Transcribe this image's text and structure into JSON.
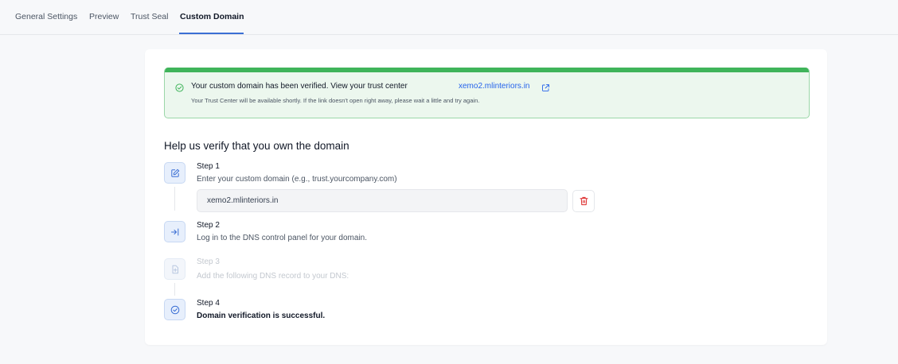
{
  "tabs": [
    {
      "label": "General Settings"
    },
    {
      "label": "Preview"
    },
    {
      "label": "Trust Seal"
    },
    {
      "label": "Custom Domain",
      "active": true
    }
  ],
  "alert": {
    "icon": "check-circle-icon",
    "title": "Your custom domain has been verified.  View your trust center",
    "link_text": "xemo2.mlinteriors.in",
    "link_icon": "external-link-icon",
    "subtitle": "Your Trust Center will be available shortly. If the link doesn't open right away, please wait a little and try again.",
    "colors": {
      "bar": "#3fb45a",
      "background": "#ecf7ee",
      "link": "#2563eb"
    }
  },
  "heading": "Help us verify that you own the domain",
  "steps": [
    {
      "title": "Step 1",
      "description": "Enter your custom domain (e.g., trust.yourcompany.com)",
      "icon": "edit-icon",
      "enabled": true
    },
    {
      "title": "Step 2",
      "description": "Log in to the DNS control panel for your domain.",
      "icon": "login-arrow-icon",
      "enabled": true
    },
    {
      "title": "Step 3",
      "description": "Add the following DNS record to your DNS:",
      "icon": "file-add-icon",
      "enabled": false
    },
    {
      "title": "Step 4",
      "description": "Domain verification is successful.",
      "icon": "check-circle-icon",
      "enabled": true
    }
  ],
  "domain_input": {
    "value": "xemo2.mlinteriors.in"
  },
  "delete_button": {
    "icon": "trash-icon",
    "color": "#dc2626"
  },
  "accent_color": "#3b6fd4"
}
